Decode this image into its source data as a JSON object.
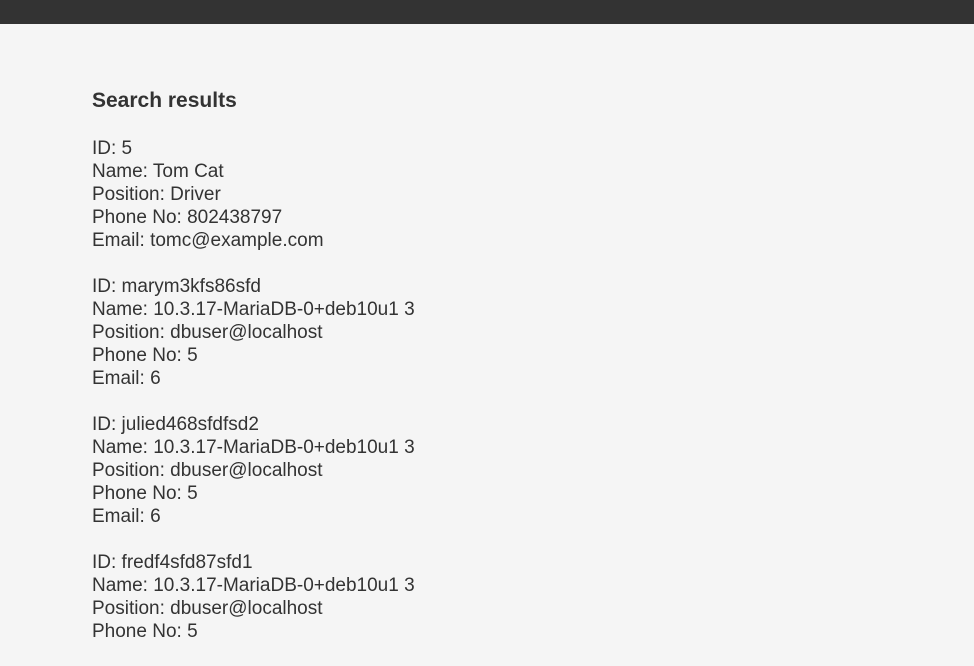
{
  "colors": {
    "topbar": "#333333",
    "background": "#f5f5f5",
    "text": "#333333"
  },
  "page": {
    "title": "Search results"
  },
  "records": [
    {
      "id": "ID: 5",
      "name": "Name: Tom Cat",
      "position": "Position: Driver",
      "phone": "Phone No: 802438797",
      "email": "Email: tomc@example.com"
    },
    {
      "id": "ID: marym3kfs86sfd",
      "name": "Name: 10.3.17-MariaDB-0+deb10u1 3",
      "position": "Position: dbuser@localhost",
      "phone": "Phone No: 5",
      "email": "Email: 6"
    },
    {
      "id": "ID: julied468sfdfsd2",
      "name": "Name: 10.3.17-MariaDB-0+deb10u1 3",
      "position": "Position: dbuser@localhost",
      "phone": "Phone No: 5",
      "email": "Email: 6"
    },
    {
      "id": "ID: fredf4sfd87sfd1",
      "name": "Name: 10.3.17-MariaDB-0+deb10u1 3",
      "position": "Position: dbuser@localhost",
      "phone": "Phone No: 5"
    }
  ]
}
